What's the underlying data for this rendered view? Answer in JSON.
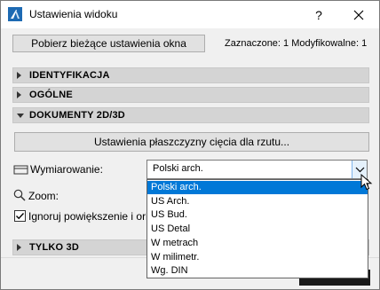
{
  "window": {
    "title": "Ustawienia widoku",
    "help_label": "?",
    "close_icon": "close-icon",
    "app_icon": "archicad-logo-icon"
  },
  "toolbar": {
    "get_settings_label": "Pobierz bieżące ustawienia okna",
    "status_text": "Zaznaczone: 1 Modyfikowalne: 1"
  },
  "sections": {
    "identification": "IDENTYFIKACJA",
    "general": "OGÓLNE",
    "documents": "DOKUMENTY 2D/3D",
    "only3d": "TYLKO 3D"
  },
  "documents": {
    "cut_plane_button": "Ustawienia płaszczyzny cięcia dla rzutu...",
    "dimensioning_label": "Wymiarowanie:",
    "dimensioning_value": "Polski arch.",
    "zoom_label": "Zoom:",
    "ignore_label": "Ignoruj powiększenie i ori",
    "ignore_checked": true,
    "dimensioning_options": [
      "Polski arch.",
      "US Arch.",
      "US Bud.",
      "US Detal",
      "W metrach",
      "W milimetr.",
      "Wg. DIN"
    ],
    "selected_option_index": 0
  },
  "colors": {
    "selection": "#0078d7",
    "section_bg": "#d4d4d4",
    "dialog_bg": "#f0f0f0"
  }
}
